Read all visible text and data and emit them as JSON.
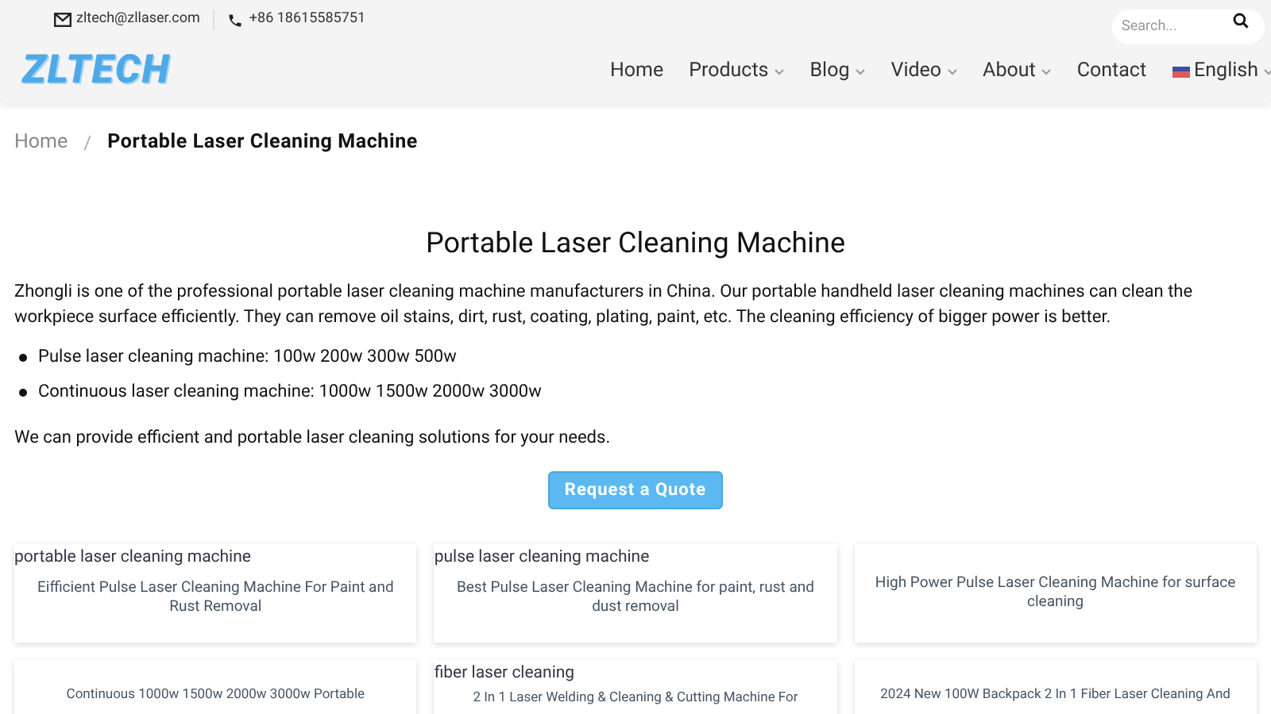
{
  "topbar": {
    "email": "zltech@zllaser.com",
    "phone": "+86 18615585751",
    "search": {
      "placeholder": "Search..."
    }
  },
  "logo": "ZLTECH",
  "nav": [
    {
      "label": "Home",
      "dropdown": false
    },
    {
      "label": "Products",
      "dropdown": true
    },
    {
      "label": "Blog",
      "dropdown": true
    },
    {
      "label": "Video",
      "dropdown": true
    },
    {
      "label": "About",
      "dropdown": true
    },
    {
      "label": "Contact",
      "dropdown": false
    },
    {
      "label": "English",
      "dropdown": true,
      "flag": true
    }
  ],
  "breadcrumb": [
    {
      "label": "Home",
      "current": false
    },
    {
      "label": "Portable Laser Cleaning Machine",
      "current": true
    }
  ],
  "breadcrumb_separator": "/",
  "heading": "Portable Laser Cleaning Machine",
  "intro": "Zhongli is one of the professional portable laser cleaning machine manufacturers in China. Our portable handheld laser cleaning machines can clean the workpiece surface efficiently. They can remove oil stains, dirt, rust, coating, plating, paint, etc. The cleaning efficiency of bigger power is better.",
  "bullets": [
    "Pulse laser cleaning machine: 100w 200w 300w 500w",
    "Continuous laser cleaning machine: 1000w 1500w 2000w 3000w"
  ],
  "outro": "We can provide efficient and portable laser cleaning solutions for your needs.",
  "cta": "Request a Quote",
  "cards": [
    {
      "tag": "portable laser cleaning machine",
      "title": "Eifficient Pulse Laser Cleaning Machine For Paint and Rust Removal"
    },
    {
      "tag": "pulse laser cleaning machine",
      "title": "Best Pulse Laser Cleaning Machine for paint, rust and dust removal"
    },
    {
      "title": "High Power Pulse Laser Cleaning Machine for surface cleaning"
    },
    {
      "title": "Continuous 1000w 1500w 2000w 3000w Portable"
    },
    {
      "tag": "fiber laser cleaning",
      "title": "2 In 1 Laser Welding & Cleaning & Cutting Machine For"
    },
    {
      "title": "2024 New 100W Backpack 2 In 1 Fiber Laser Cleaning And"
    }
  ]
}
